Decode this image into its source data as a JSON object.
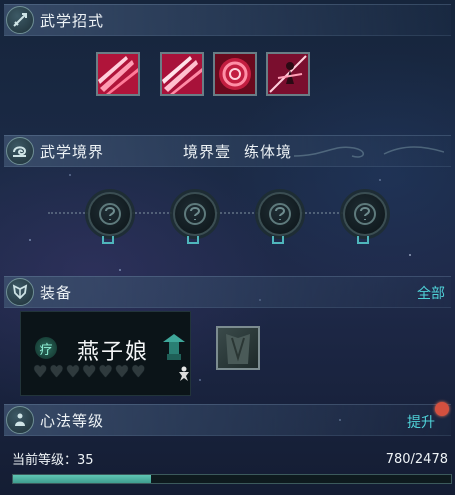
{
  "martial_moves": {
    "title": "武学招式",
    "skills": [
      {
        "icon": "claw-slash-skill-icon"
      },
      {
        "icon": "claw-slash-skill-icon"
      },
      {
        "icon": "rose-vortex-skill-icon"
      },
      {
        "icon": "sword-dancer-skill-icon"
      }
    ]
  },
  "martial_realm": {
    "title": "武学境界",
    "realm_level": "境界壹",
    "realm_name": "练体境",
    "nodes": [
      {
        "state": "locked"
      },
      {
        "state": "locked"
      },
      {
        "state": "locked"
      },
      {
        "state": "locked"
      }
    ]
  },
  "equipment": {
    "title": "装备",
    "all_link": "全部",
    "companion_name": "燕子娘",
    "companion_badge": "疗",
    "hearts_total": 7,
    "hearts_filled": 0
  },
  "mind_method": {
    "title": "心法等级",
    "upgrade_label": "提升",
    "level_label": "当前等级：35",
    "exp_text": "780/2478",
    "exp_current": 780,
    "exp_max": 2478
  },
  "colors": {
    "accent": "#4fd2d8",
    "progress": "#5fc6b4",
    "notification": "#d3503f"
  }
}
